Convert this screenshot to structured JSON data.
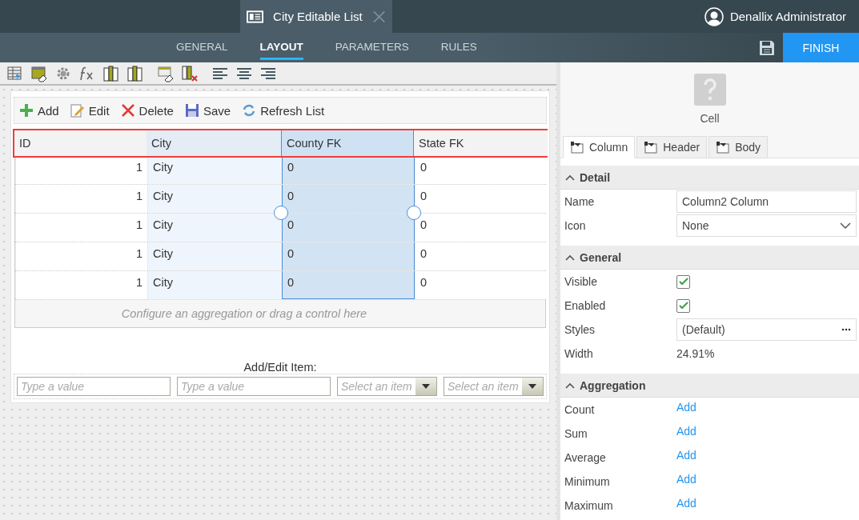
{
  "document_tab": {
    "title": "City Editable List"
  },
  "user": {
    "name": "Denallix Administrator"
  },
  "nav_tabs": [
    {
      "label": "GENERAL",
      "selected": false
    },
    {
      "label": "LAYOUT",
      "selected": true
    },
    {
      "label": "PARAMETERS",
      "selected": false
    },
    {
      "label": "RULES",
      "selected": false
    }
  ],
  "finish_button": "FINISH",
  "list_toolbar": [
    {
      "kind": "add",
      "label": "Add"
    },
    {
      "kind": "edit",
      "label": "Edit"
    },
    {
      "kind": "delete",
      "label": "Delete"
    },
    {
      "kind": "save",
      "label": "Save"
    },
    {
      "kind": "refresh",
      "label": "Refresh List"
    }
  ],
  "table": {
    "header_highlighted": true,
    "columns": [
      {
        "label": "ID",
        "right_aligned": true,
        "selected": false,
        "hovered": false
      },
      {
        "label": "City",
        "right_aligned": false,
        "selected": false,
        "hovered": true
      },
      {
        "label": "County FK",
        "right_aligned": false,
        "selected": true,
        "hovered": false
      },
      {
        "label": "State FK",
        "right_aligned": false,
        "selected": false,
        "hovered": false
      }
    ],
    "rows": [
      [
        "1",
        "City",
        "0",
        "0"
      ],
      [
        "1",
        "City",
        "0",
        "0"
      ],
      [
        "1",
        "City",
        "0",
        "0"
      ],
      [
        "1",
        "City",
        "0",
        "0"
      ],
      [
        "1",
        "City",
        "0",
        "0"
      ]
    ],
    "footer_hint": "Configure an aggregation or drag a control here"
  },
  "add_edit": {
    "title": "Add/Edit Item:",
    "fields": [
      {
        "kind": "text",
        "placeholder": "Type a value"
      },
      {
        "kind": "text",
        "placeholder": "Type a value"
      },
      {
        "kind": "select",
        "placeholder": "Select an item"
      },
      {
        "kind": "select",
        "placeholder": "Select an item"
      }
    ]
  },
  "properties": {
    "control_title": "Cell",
    "tabs": [
      {
        "label": "Column",
        "selected": true
      },
      {
        "label": "Header",
        "selected": false
      },
      {
        "label": "Body",
        "selected": false
      }
    ],
    "sections": [
      {
        "title": "Detail",
        "expanded": true,
        "rows": [
          {
            "label": "Name",
            "kind": "input",
            "value": "Column2 Column"
          },
          {
            "label": "Icon",
            "kind": "dropdown",
            "value": "None"
          }
        ]
      },
      {
        "title": "General",
        "expanded": true,
        "rows": [
          {
            "label": "Visible",
            "kind": "checkbox",
            "checked": true
          },
          {
            "label": "Enabled",
            "kind": "checkbox",
            "checked": true
          },
          {
            "label": "Styles",
            "kind": "picker",
            "value": "(Default)"
          },
          {
            "label": "Width",
            "kind": "text",
            "value": "24.91%"
          }
        ]
      },
      {
        "title": "Aggregation",
        "expanded": true,
        "rows": [
          {
            "label": "Count",
            "kind": "link",
            "value": "Add"
          },
          {
            "label": "Sum",
            "kind": "link",
            "value": "Add"
          },
          {
            "label": "Average",
            "kind": "link",
            "value": "Add"
          },
          {
            "label": "Minimum",
            "kind": "link",
            "value": "Add"
          },
          {
            "label": "Maximum",
            "kind": "link",
            "value": "Add"
          }
        ]
      }
    ]
  }
}
